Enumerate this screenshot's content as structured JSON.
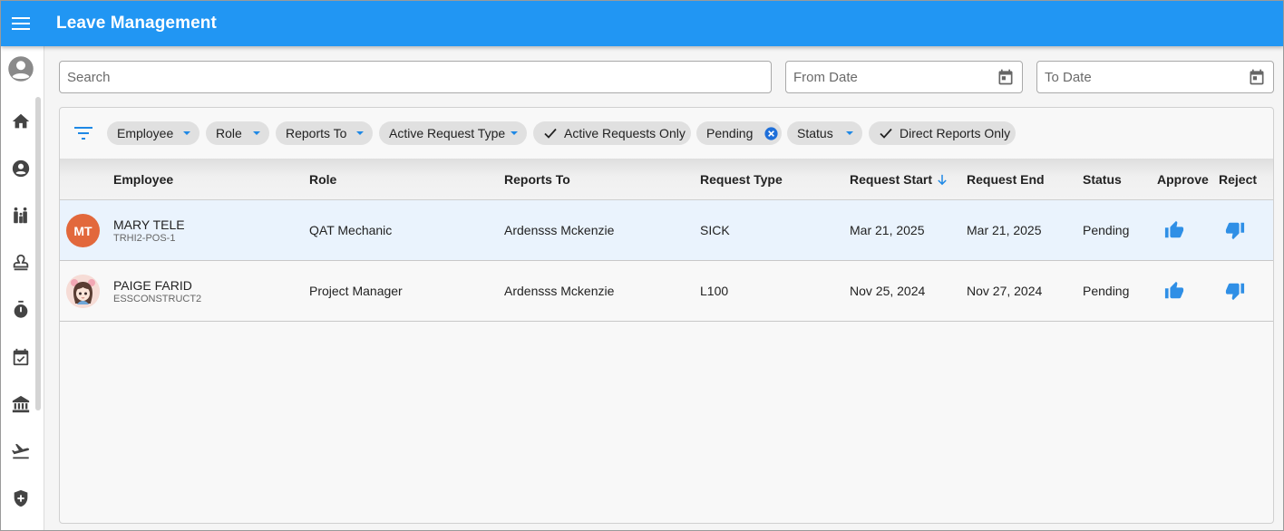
{
  "app": {
    "title": "Leave Management",
    "accent": "#2196f3"
  },
  "sidebar": {
    "items": [
      {
        "icon": "account-circle-icon"
      },
      {
        "icon": "home-icon"
      },
      {
        "icon": "person-icon"
      },
      {
        "icon": "family-icon"
      },
      {
        "icon": "stamp-icon"
      },
      {
        "icon": "stopwatch-icon"
      },
      {
        "icon": "calendar-check-icon"
      },
      {
        "icon": "bank-icon"
      },
      {
        "icon": "flight-takeoff-icon"
      },
      {
        "icon": "shield-plus-icon"
      }
    ]
  },
  "search": {
    "placeholder": "Search",
    "value": ""
  },
  "from_date": {
    "placeholder": "From Date",
    "value": ""
  },
  "to_date": {
    "placeholder": "To Date",
    "value": ""
  },
  "filters": {
    "chips": [
      {
        "label": "Employee",
        "kind": "dropdown"
      },
      {
        "label": "Role",
        "kind": "dropdown"
      },
      {
        "label": "Reports To",
        "kind": "dropdown"
      },
      {
        "label": "Active Request Type",
        "kind": "dropdown"
      },
      {
        "label": "Active Requests Only",
        "kind": "toggle",
        "checked": true
      },
      {
        "label": "Pending",
        "kind": "removable"
      },
      {
        "label": "Status",
        "kind": "dropdown"
      },
      {
        "label": "Direct Reports Only",
        "kind": "toggle",
        "checked": true
      }
    ]
  },
  "table": {
    "columns": [
      "Employee",
      "Role",
      "Reports To",
      "Request Type",
      "Request Start",
      "Request End",
      "Status",
      "Approve",
      "Reject"
    ],
    "sort": {
      "column": "Request Start",
      "direction": "desc"
    },
    "rows": [
      {
        "initials": "MT",
        "avatar_color": "#e2683c",
        "name": "MARY TELE",
        "code": "TRHI2-POS-1",
        "role": "QAT Mechanic",
        "reports_to": "Ardensss Mckenzie",
        "request_type": "SICK",
        "start": "Mar 21, 2025",
        "end": "Mar 21, 2025",
        "status": "Pending",
        "selected": true
      },
      {
        "initials": "",
        "avatar_color": "#f4d9d4",
        "name": "PAIGE FARID",
        "code": "ESSCONSTRUCT2",
        "role": "Project Manager",
        "reports_to": "Ardensss Mckenzie",
        "request_type": "L100",
        "start": "Nov 25, 2024",
        "end": "Nov 27, 2024",
        "status": "Pending",
        "selected": false
      }
    ]
  }
}
